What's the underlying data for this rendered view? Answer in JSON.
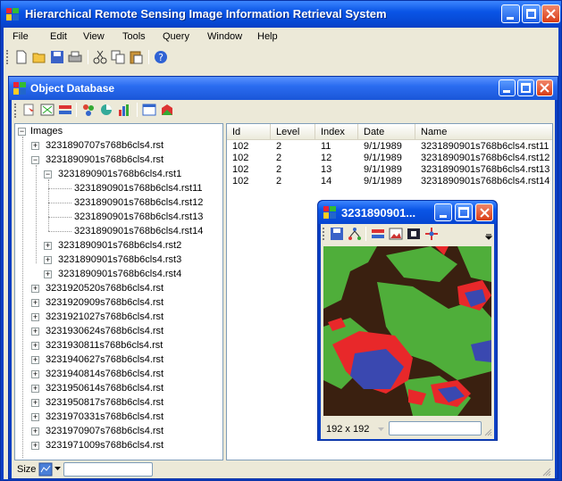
{
  "main_window": {
    "title": "Hierarchical Remote Sensing Image Information Retrieval System"
  },
  "menu": [
    "File",
    "Edit",
    "View",
    "Tools",
    "Query",
    "Window",
    "Help"
  ],
  "toolbar_icons": [
    "new-file-icon",
    "open-folder-icon",
    "save-icon",
    "print-icon",
    "cut-icon",
    "copy-icon",
    "paste-icon",
    "help-icon"
  ],
  "object_db": {
    "title": "Object Database",
    "toolbar_icons": [
      "refresh-icon",
      "map-icon",
      "layers-icon",
      "segment-icon",
      "circle-icon",
      "chart-icon",
      "window-icon",
      "palette-icon"
    ]
  },
  "tree": {
    "root": "Images",
    "expanded_image": "3231890901s768b6cls4.rst",
    "level1_expanded": "3231890901s768b6cls4.rst1",
    "leaves": [
      "3231890901s768b6cls4.rst11",
      "3231890901s768b6cls4.rst12",
      "3231890901s768b6cls4.rst13",
      "3231890901s768b6cls4.rst14"
    ],
    "level1_collapsed": [
      "3231890901s768b6cls4.rst2",
      "3231890901s768b6cls4.rst3",
      "3231890901s768b6cls4.rst4"
    ],
    "first_image": "3231890707s768b6cls4.rst",
    "other_images": [
      "3231920520s768b6cls4.rst",
      "3231920909s768b6cls4.rst",
      "3231921027s768b6cls4.rst",
      "3231930624s768b6cls4.rst",
      "3231930811s768b6cls4.rst",
      "3231940627s768b6cls4.rst",
      "3231940814s768b6cls4.rst",
      "3231950614s768b6cls4.rst",
      "3231950817s768b6cls4.rst",
      "3231970331s768b6cls4.rst",
      "3231970907s768b6cls4.rst",
      "3231971009s768b6cls4.rst"
    ]
  },
  "list": {
    "headers": [
      "Id",
      "Level",
      "Index",
      "Date",
      "Name"
    ],
    "rows": [
      [
        "102",
        "2",
        "11",
        "9/1/1989",
        "3231890901s768b6cls4.rst11"
      ],
      [
        "102",
        "2",
        "12",
        "9/1/1989",
        "3231890901s768b6cls4.rst12"
      ],
      [
        "102",
        "2",
        "13",
        "9/1/1989",
        "3231890901s768b6cls4.rst13"
      ],
      [
        "102",
        "2",
        "14",
        "9/1/1989",
        "3231890901s768b6cls4.rst14"
      ]
    ]
  },
  "status": {
    "size_label": "Size",
    "value": ""
  },
  "image_viewer": {
    "title": "3231890901...",
    "size": "192 x 192",
    "colors": {
      "background": "#3a2010",
      "vegetation": "#4fae3a",
      "class_red": "#e8282a",
      "class_blue": "#3a48b0"
    }
  }
}
